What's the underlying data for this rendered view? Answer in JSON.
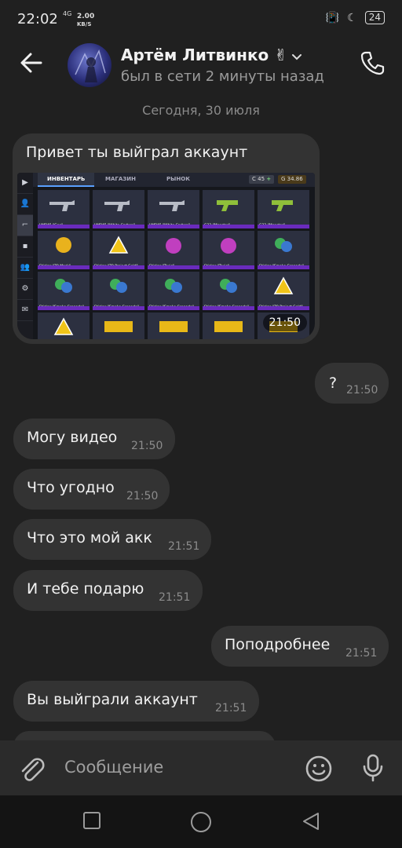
{
  "status_bar": {
    "time": "22:02",
    "signal": "4G",
    "speed_value": "2.00",
    "speed_unit": "KB/S",
    "battery": "24"
  },
  "header": {
    "name": "Артём Литвинко ✌",
    "last_seen": "был в сети 2 минуты назад"
  },
  "date_separator": "Сегодня, 30 июля",
  "messages": [
    {
      "text": "Привет ты выйграл аккаунт",
      "time": "21:50"
    },
    {
      "text": "?",
      "time": "21:50"
    },
    {
      "text": "Могу видео",
      "time": "21:50"
    },
    {
      "text": "Что угодно",
      "time": "21:50"
    },
    {
      "text": "Что это мой акк",
      "time": "21:51"
    },
    {
      "text": "И тебе подарю",
      "time": "21:51"
    },
    {
      "text": "Поподробнее",
      "time": "21:51"
    },
    {
      "text": "Вы выйграли аккаунт",
      "time": "21:51"
    }
  ],
  "game": {
    "tabs": [
      "ИНВЕНТАРЬ",
      "МАГАЗИН",
      "РЫНОК"
    ],
    "balance_1": "45",
    "balance_2": "34.86",
    "items": [
      "UMP45 \"Geo\"",
      "UMP45 \"White Carbon\"",
      "UMP45 \"White Carbon\"",
      "G22 \"Monster\"",
      "G22 \"Monster\"",
      "Sticker \"Z9 Mask\"",
      "Sticker \"Z9 Project Gold\"",
      "Sticker \"Toxic\"",
      "Sticker \"Toxic\"",
      "Sticker \"Smoke Grenade\"",
      "Sticker \"Smoke Grenade\"",
      "Sticker \"Smoke Grenade\"",
      "Sticker \"Smoke Grenade\"",
      "Sticker \"Smoke Grenade\"",
      "Sticker \"Z9 Project Gold\"",
      "Sticker \"Z9 Project Gold\"",
      "Sticker \"Biohazard\"",
      "Sticker \"Biohazard\"",
      "Sticker \"Biohazard\"",
      "Sticker \"Biohazard\""
    ]
  },
  "composer": {
    "placeholder": "Сообщение"
  },
  "icons": {
    "back": "arrow-left-icon",
    "call": "phone-icon",
    "attach": "paperclip-icon",
    "emoji": "smiley-icon",
    "mic": "microphone-icon",
    "nav_recent": "square-icon",
    "nav_home": "circle-icon",
    "nav_back": "triangle-icon"
  }
}
